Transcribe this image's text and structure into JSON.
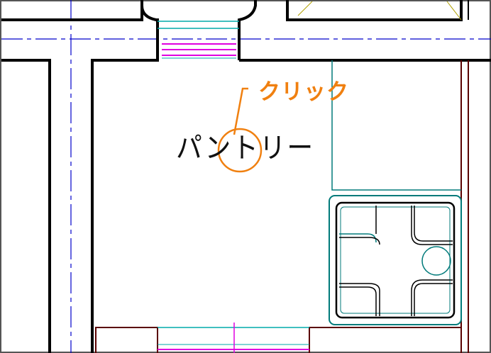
{
  "plan": {
    "room_label": "パントリー",
    "colors": {
      "wall": "#000000",
      "centerline": "#0000cc",
      "window": "#00aaaa",
      "door": "#e000e0",
      "cabinet": "#5a0000",
      "appliance": "#007a7a"
    }
  },
  "annotation": {
    "callout_text": "クリック",
    "callout_color": "#f08010"
  },
  "icons": {
    "click_marker": "circle-marker-icon",
    "stove": "stove-icon"
  }
}
